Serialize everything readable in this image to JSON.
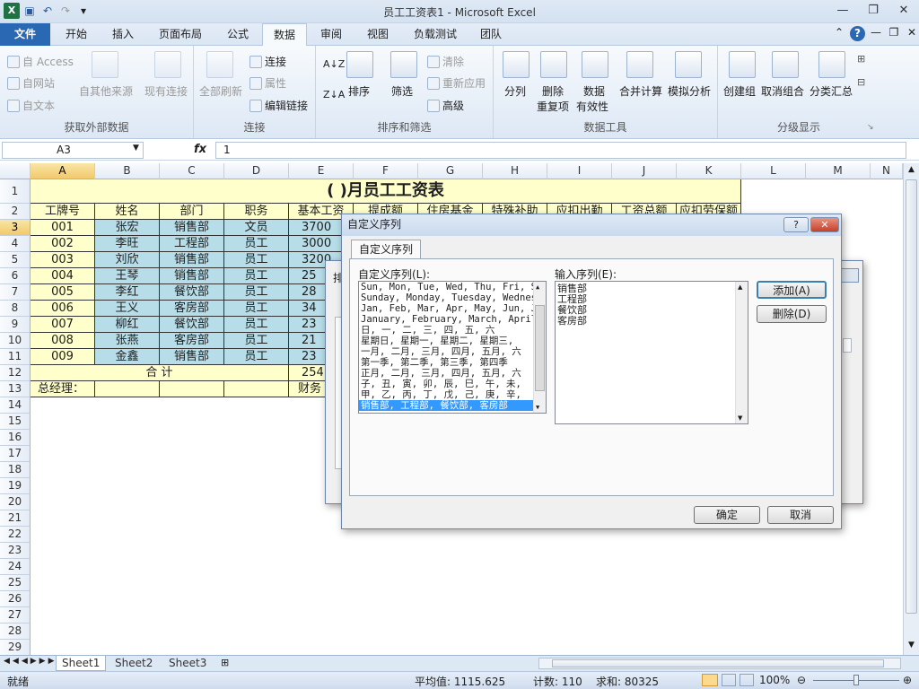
{
  "window": {
    "title": "员工工资表1 - Microsoft Excel"
  },
  "ribbon_tabs": [
    "文件",
    "开始",
    "插入",
    "页面布局",
    "公式",
    "数据",
    "审阅",
    "视图",
    "负载测试",
    "团队"
  ],
  "ribbon": {
    "get_external": {
      "access": "自 Access",
      "web": "自网站",
      "text": "自文本",
      "other": "自其他来源",
      "existing": "现有连接",
      "label": "获取外部数据"
    },
    "connections": {
      "refresh_all": "全部刷新",
      "connections": "连接",
      "properties": "属性",
      "edit_links": "编辑链接",
      "label": "连接"
    },
    "sort_filter": {
      "sort": "排序",
      "filter": "筛选",
      "clear": "清除",
      "reapply": "重新应用",
      "advanced": "高级",
      "label": "排序和筛选"
    },
    "data_tools": {
      "split": "分列",
      "remove_dup_1": "删除",
      "remove_dup_2": "重复项",
      "validation_1": "数据",
      "validation_2": "有效性",
      "consolidate": "合并计算",
      "whatif": "模拟分析",
      "label": "数据工具"
    },
    "outline": {
      "group": "创建组",
      "ungroup": "取消组合",
      "subtotal": "分类汇总",
      "label": "分级显示"
    }
  },
  "formula_bar": {
    "name_box": "A3",
    "fx": "fx",
    "value": "1"
  },
  "columns": [
    "A",
    "B",
    "C",
    "D",
    "E",
    "F",
    "G",
    "H",
    "I",
    "J",
    "K",
    "L",
    "M",
    "N"
  ],
  "sheet": {
    "title": "( )月员工工资表",
    "headers": [
      "工牌号",
      "姓名",
      "部门",
      "职务",
      "基本工资",
      "提成额",
      "住房基金",
      "特殊补助",
      "应扣出勤",
      "工资总额",
      "应扣劳保额"
    ],
    "rows": [
      [
        "001",
        "张宏",
        "销售部",
        "文员",
        "3700"
      ],
      [
        "002",
        "李旺",
        "工程部",
        "员工",
        "3000"
      ],
      [
        "003",
        "刘欣",
        "销售部",
        "员工",
        "3200"
      ],
      [
        "004",
        "王琴",
        "销售部",
        "员工",
        "25"
      ],
      [
        "005",
        "李红",
        "餐饮部",
        "员工",
        "28"
      ],
      [
        "006",
        "王义",
        "客房部",
        "员工",
        "34"
      ],
      [
        "007",
        "柳红",
        "餐饮部",
        "员工",
        "23"
      ],
      [
        "008",
        "张燕",
        "客房部",
        "员工",
        "21"
      ],
      [
        "009",
        "金鑫",
        "销售部",
        "员工",
        "23"
      ]
    ],
    "total_label": "合  计",
    "total_value": "254",
    "manager_label": "总经理：",
    "finance_label": "财务"
  },
  "row_numbers": [
    "1",
    "2",
    "3",
    "4",
    "5",
    "6",
    "7",
    "8",
    "9",
    "10",
    "11",
    "12",
    "13",
    "14",
    "15",
    "16",
    "17",
    "18",
    "19",
    "20",
    "21",
    "22",
    "23",
    "24",
    "25",
    "26",
    "27",
    "28",
    "29"
  ],
  "sheet_tabs": [
    "Sheet1",
    "Sheet2",
    "Sheet3"
  ],
  "status": {
    "ready": "就绪",
    "average": "平均值: 1115.625",
    "count": "计数: 110",
    "sum": "求和: 80325",
    "zoom": "100%"
  },
  "dialog": {
    "title": "自定义序列",
    "help": "?",
    "close": "✕",
    "tab": "自定义序列",
    "list_label": "自定义序列(L):",
    "input_label": "输入序列(E):",
    "lists": [
      "Sun, Mon, Tue, Wed, Thu, Fri, S",
      "Sunday, Monday, Tuesday, Wednes",
      "Jan, Feb, Mar, Apr, May, Jun, J",
      "January, February, March, April,",
      "日, 一, 二, 三, 四, 五, 六",
      "星期日, 星期一, 星期二, 星期三,",
      "一月, 二月, 三月, 四月, 五月, 六",
      "第一季, 第二季, 第三季, 第四季",
      "正月, 二月, 三月, 四月, 五月, 六",
      "子, 丑, 寅, 卯, 辰, 巳, 午, 未,",
      "甲, 乙, 丙, 丁, 戊, 己, 庚, 辛,",
      "销售部, 工程部, 餐饮部, 客房部"
    ],
    "entries": [
      "销售部",
      "工程部",
      "餐饮部",
      "客房部"
    ],
    "add": "添加(A)",
    "delete": "删除(D)",
    "ok": "确定",
    "cancel": "取消"
  },
  "back_dialog": {
    "partial_title": "排"
  }
}
